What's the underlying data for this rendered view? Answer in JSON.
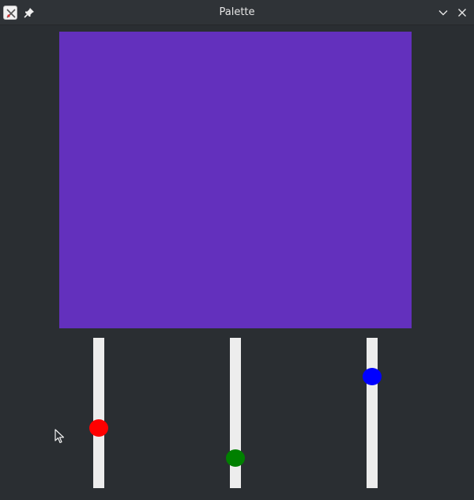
{
  "window": {
    "title": "Palette",
    "app_icon": "palette-app-icon",
    "pin_icon": "pin-icon",
    "minimize_icon": "chevron-down-icon",
    "close_icon": "close-icon"
  },
  "preview": {
    "color": "#6330bd"
  },
  "sliders": [
    {
      "channel": "red",
      "knob_color": "#ff0000",
      "level": 0.4
    },
    {
      "channel": "green",
      "knob_color": "#008000",
      "level": 0.2
    },
    {
      "channel": "blue",
      "knob_color": "#0000ff",
      "level": 0.74
    }
  ],
  "colors": {
    "window_bg": "#2a2e32",
    "titlebar_bg": "#2f3337",
    "track": "#ededed"
  }
}
